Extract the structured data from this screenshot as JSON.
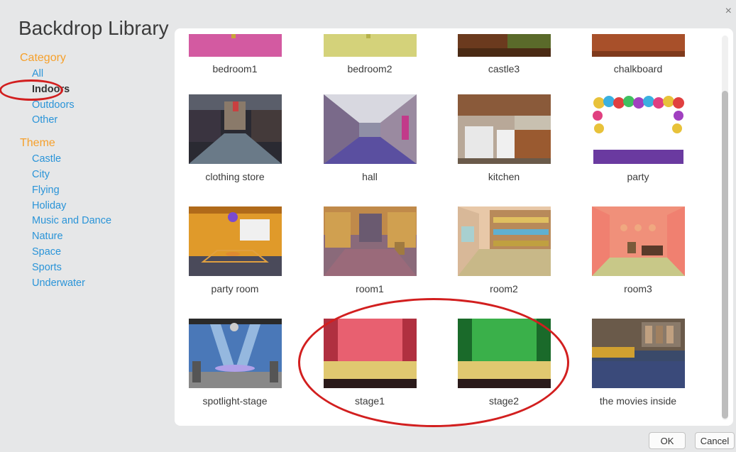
{
  "dialog": {
    "title": "Backdrop Library",
    "close_label": "×",
    "ok_label": "OK",
    "cancel_label": "Cancel"
  },
  "sidebar": {
    "category_heading": "Category",
    "categories": [
      "All",
      "Indoors",
      "Outdoors",
      "Other"
    ],
    "selected_category": "Indoors",
    "theme_heading": "Theme",
    "themes": [
      "Castle",
      "City",
      "Flying",
      "Holiday",
      "Music and Dance",
      "Nature",
      "Space",
      "Sports",
      "Underwater"
    ]
  },
  "backdrops": [
    {
      "name": "bedroom1"
    },
    {
      "name": "bedroom2"
    },
    {
      "name": "castle3"
    },
    {
      "name": "chalkboard"
    },
    {
      "name": "clothing store"
    },
    {
      "name": "hall"
    },
    {
      "name": "kitchen"
    },
    {
      "name": "party"
    },
    {
      "name": "party room"
    },
    {
      "name": "room1"
    },
    {
      "name": "room2"
    },
    {
      "name": "room3"
    },
    {
      "name": "spotlight-stage"
    },
    {
      "name": "stage1"
    },
    {
      "name": "stage2"
    },
    {
      "name": "the movies inside"
    }
  ],
  "colors": {
    "accent_orange": "#f6a02b",
    "link_blue": "#2a94d8",
    "highlight_red": "#d21f1f"
  }
}
